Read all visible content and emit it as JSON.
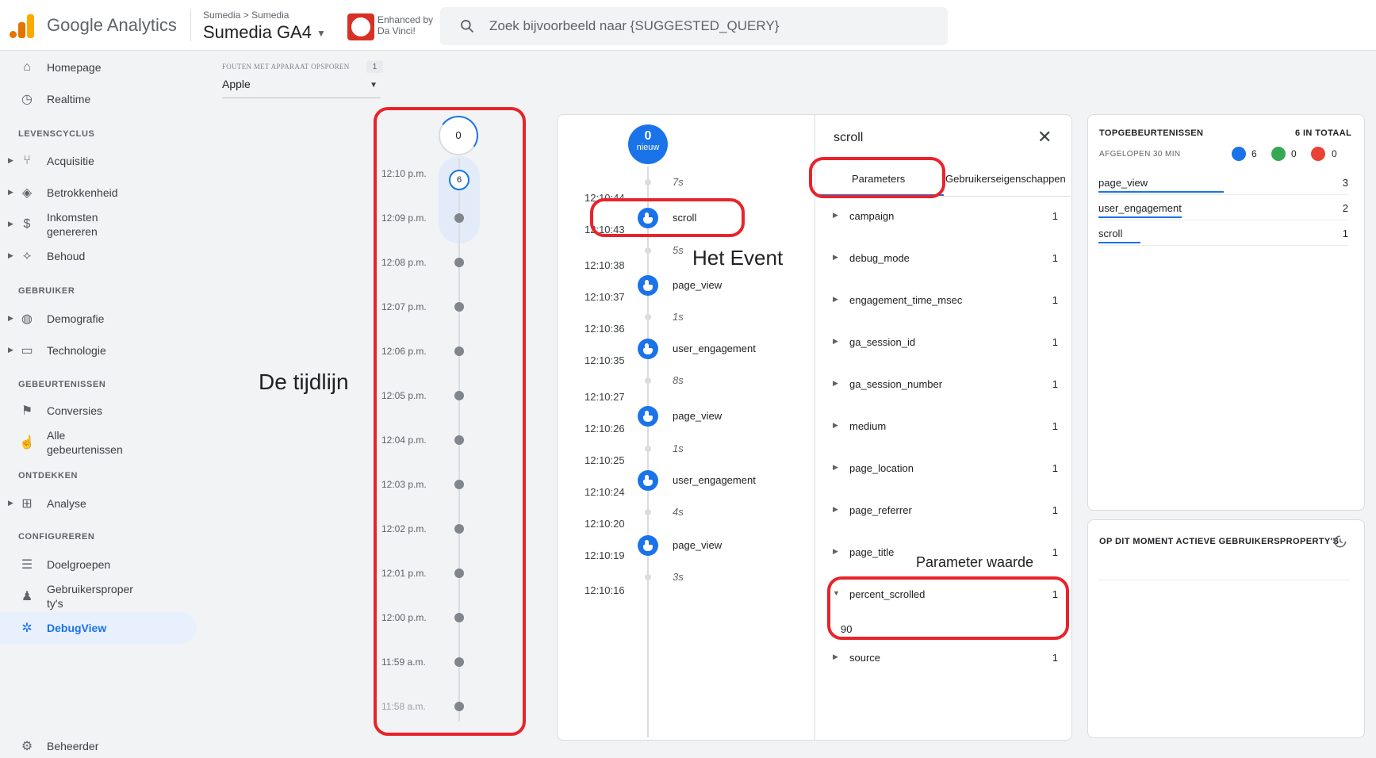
{
  "header": {
    "product_name": "Google Analytics",
    "breadcrumb": [
      "Sumedia",
      ">",
      "Sumedia"
    ],
    "property_name": "Sumedia GA4",
    "enhanced_by_line1": "Enhanced by",
    "enhanced_by_line2": "Da Vinci!",
    "search_placeholder": "Zoek bijvoorbeeld naar {SUGGESTED_QUERY}",
    "brand_colors": {
      "bar_left": "#e37400",
      "bar_mid": "#f9ab00",
      "bar_right": "#e37400"
    }
  },
  "sidebar": {
    "items_top": [
      {
        "label": "Homepage",
        "icon": "home-icon"
      },
      {
        "label": "Realtime",
        "icon": "clock-icon"
      }
    ],
    "sections": [
      {
        "label": "LEVENSCYCLUS",
        "items": [
          {
            "label": "Acquisitie",
            "icon": "acquisition-icon"
          },
          {
            "label": "Betrokkenheid",
            "icon": "tag-icon"
          },
          {
            "label": "Inkomsten",
            "label2": "genereren",
            "icon": "dollar-icon"
          },
          {
            "label": "Behoud",
            "icon": "retention-icon"
          }
        ]
      },
      {
        "label": "GEBRUIKER",
        "items": [
          {
            "label": "Demografie",
            "icon": "globe-icon"
          },
          {
            "label": "Technologie",
            "icon": "devices-icon"
          }
        ]
      },
      {
        "label": "GEBEURTENISSEN",
        "items": [
          {
            "label": "Conversies",
            "icon": "flag-icon"
          },
          {
            "label": "Alle",
            "label2": "gebeurtenissen",
            "icon": "touch-icon"
          }
        ]
      },
      {
        "label": "ONTDEKKEN",
        "items": [
          {
            "label": "Analyse",
            "icon": "analysis-icon"
          }
        ]
      },
      {
        "label": "CONFIGUREREN",
        "items": [
          {
            "label": "Doelgroepen",
            "icon": "audience-icon"
          },
          {
            "label": "Gebruikersproper",
            "label2": "ty's",
            "icon": "user-property-icon"
          },
          {
            "label": "DebugView",
            "icon": "bug-icon"
          }
        ]
      }
    ],
    "admin_label": "Beheerder"
  },
  "device": {
    "label": "FOUTEN MET APPARAAT OPSPOREN",
    "count": "1",
    "selected": "Apple"
  },
  "annotations": {
    "timeline": "De tijdlijn",
    "event": "Het Event",
    "parameter_value": "Parameter waarde"
  },
  "timeline": {
    "top_count": "0",
    "current_count": "6",
    "times": [
      "12:10 p.m.",
      "12:09 p.m.",
      "12:08 p.m.",
      "12:07 p.m.",
      "12:06 p.m.",
      "12:05 p.m.",
      "12:04 p.m.",
      "12:03 p.m.",
      "12:02 p.m.",
      "12:01 p.m.",
      "12:00 p.m.",
      "11:59 a.m.",
      "11:58 a.m."
    ]
  },
  "stream": {
    "new_count": "0",
    "new_label": "nieuw",
    "durations": [
      "7s",
      "5s",
      "1s",
      "8s",
      "1s",
      "4s",
      "3s"
    ],
    "times": [
      "12:10:44",
      "12:10:43",
      "12:10:38",
      "12:10:37",
      "12:10:36",
      "12:10:35",
      "12:10:27",
      "12:10:26",
      "12:10:25",
      "12:10:24",
      "12:10:20",
      "12:10:19",
      "12:10:16"
    ],
    "events": [
      "scroll",
      "page_view",
      "user_engagement",
      "page_view",
      "user_engagement",
      "page_view"
    ]
  },
  "detail": {
    "title": "scroll",
    "tabs": [
      "Parameters",
      "Gebruikerseigenschappen"
    ],
    "params": [
      {
        "name": "campaign",
        "count": "1"
      },
      {
        "name": "debug_mode",
        "count": "1"
      },
      {
        "name": "engagement_time_msec",
        "count": "1"
      },
      {
        "name": "ga_session_id",
        "count": "1"
      },
      {
        "name": "ga_session_number",
        "count": "1"
      },
      {
        "name": "medium",
        "count": "1"
      },
      {
        "name": "page_location",
        "count": "1"
      },
      {
        "name": "page_referrer",
        "count": "1"
      },
      {
        "name": "page_title",
        "count": "1"
      },
      {
        "name": "percent_scrolled",
        "count": "1"
      },
      {
        "name": "source",
        "count": "1"
      }
    ],
    "expanded_value": "90"
  },
  "top_events": {
    "title": "TOPGEBEURTENISSEN",
    "total": "6 IN TOTAAL",
    "period": "AFGELOPEN 30 MIN",
    "counts": {
      "events": "6",
      "conversions": "0",
      "errors": "0"
    },
    "rows": [
      {
        "name": "page_view",
        "value": "3",
        "share": 0.5
      },
      {
        "name": "user_engagement",
        "value": "2",
        "share": 0.333
      },
      {
        "name": "scroll",
        "value": "1",
        "share": 0.167
      }
    ]
  },
  "user_props": {
    "title": "OP DIT MOMENT ACTIEVE GEBRUIKERSPROPERTY'S"
  }
}
